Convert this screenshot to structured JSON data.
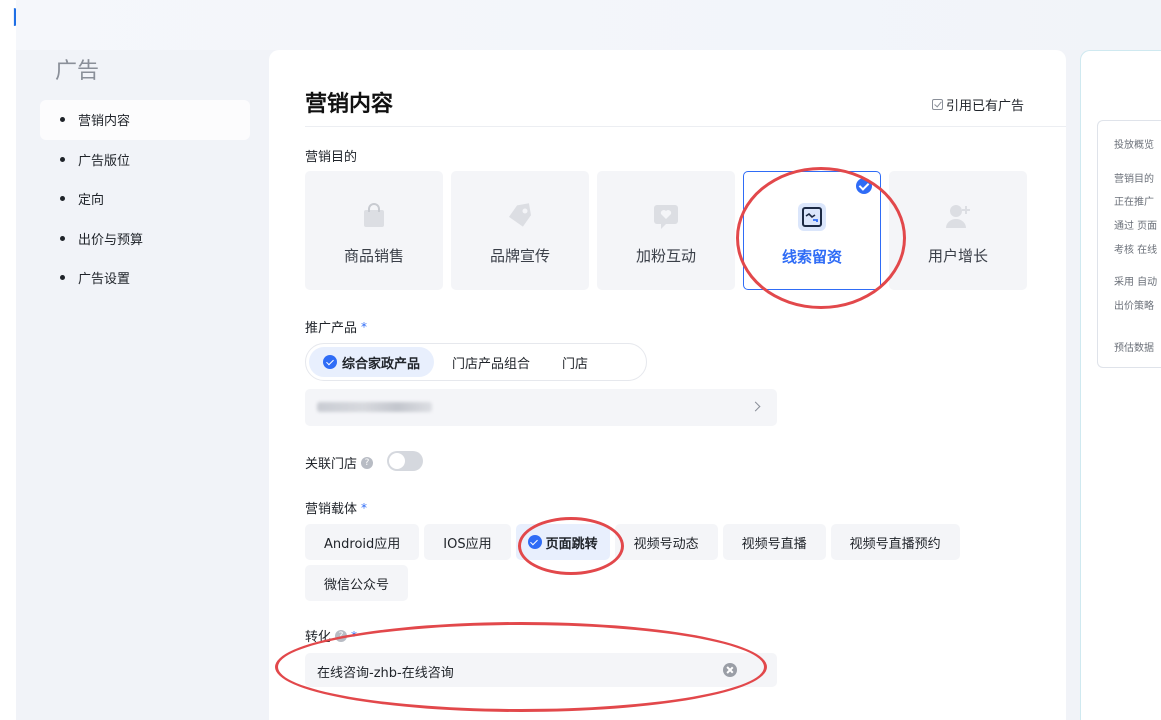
{
  "sidebar": {
    "title": "广告",
    "items": [
      {
        "label": "营销内容"
      },
      {
        "label": "广告版位"
      },
      {
        "label": "定向"
      },
      {
        "label": "出价与预算"
      },
      {
        "label": "广告设置"
      }
    ]
  },
  "main": {
    "title": "营销内容",
    "ref_link": "引用已有广告",
    "goal": {
      "label": "营销目的",
      "options": [
        {
          "label": "商品销售",
          "icon": "shopping-bag-icon"
        },
        {
          "label": "品牌宣传",
          "icon": "tag-icon"
        },
        {
          "label": "加粉互动",
          "icon": "heart-chat-icon"
        },
        {
          "label": "线索留资",
          "icon": "lead-form-icon",
          "selected": true
        },
        {
          "label": "用户增长",
          "icon": "add-user-icon"
        }
      ]
    },
    "product": {
      "label": "推广产品",
      "required_mark": "*",
      "options": [
        {
          "label": "综合家政产品",
          "selected": true
        },
        {
          "label": "门店产品组合"
        },
        {
          "label": "门店"
        }
      ]
    },
    "store_link": {
      "label": "关联门店",
      "enabled": false
    },
    "carrier": {
      "label": "营销载体",
      "required_mark": "*",
      "options": [
        {
          "label": "Android应用"
        },
        {
          "label": "IOS应用"
        },
        {
          "label": "页面跳转",
          "selected": true
        },
        {
          "label": "视频号动态"
        },
        {
          "label": "视频号直播"
        },
        {
          "label": "视频号直播预约"
        },
        {
          "label": "微信公众号"
        }
      ]
    },
    "conversion": {
      "label": "转化",
      "required_mark": "*",
      "value": "在线咨询-zhb-在线咨询"
    }
  },
  "right_panel": {
    "title": "投放概览",
    "lines": [
      "营销目的",
      "正在推广",
      "通过  页面",
      "考核  在线",
      "采用  自动",
      "出价策略",
      "预估数据"
    ]
  },
  "colors": {
    "accent": "#2f6cf6",
    "annotation": "#e2484b"
  }
}
